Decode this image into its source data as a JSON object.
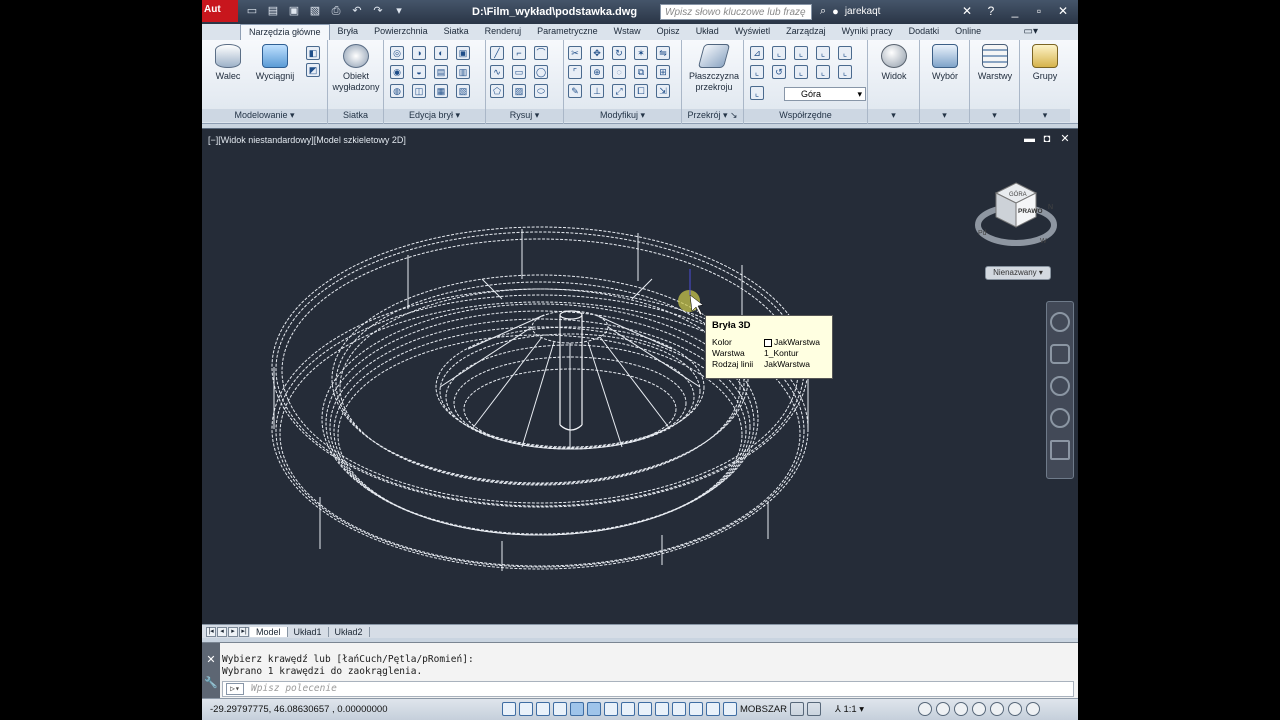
{
  "titlebar": {
    "app_logo": "Aut",
    "doc_title": "D:\\Film_wykład\\podstawka.dwg",
    "search_placeholder": "Wpisz słowo kluczowe lub frazę",
    "user_name": "jarekaqt"
  },
  "tabs": [
    "Narzędzia główne",
    "Bryła",
    "Powierzchnia",
    "Siatka",
    "Renderuj",
    "Parametryczne",
    "Wstaw",
    "Opisz",
    "Układ",
    "Wyświetl",
    "Zarządzaj",
    "Wyniki pracy",
    "Dodatki",
    "Online"
  ],
  "active_tab": "Narzędzia główne",
  "ribbon": {
    "panels": {
      "modelowanie": "Modelowanie",
      "siatka": "Siatka",
      "edycja_bryl": "Edycja brył",
      "rysuj": "Rysuj",
      "modyfikuj": "Modyfikuj",
      "przekroj": "Przekrój",
      "wspolrzedne": "Współrzędne"
    },
    "buttons": {
      "walec": "Walec",
      "wyciagnij": "Wyciągnij",
      "obiekt_wygladzony_1": "Obiekt",
      "obiekt_wygladzony_2": "wygładzony",
      "plaszczyzna_1": "Płaszczyzna",
      "plaszczyzna_2": "przekroju",
      "widok": "Widok",
      "wybor": "Wybór",
      "warstwy": "Warstwy",
      "grupy": "Grupy"
    },
    "view_combo": "Góra"
  },
  "viewport": {
    "label": "[−][Widok niestandardowy][Model szkieletowy 2D]",
    "viewcube_face": "PRAWO",
    "viewcube_top": "GÓRA",
    "compass": [
      "Pd",
      "W",
      "N"
    ],
    "named_view": "Nienazwany"
  },
  "tooltip": {
    "title": "Bryła 3D",
    "rows": [
      {
        "key": "Kolor",
        "value": "JakWarstwa"
      },
      {
        "key": "Warstwa",
        "value": "1_Kontur"
      },
      {
        "key": "Rodzaj linii",
        "value": "JakWarstwa"
      }
    ]
  },
  "layout_tabs": [
    "Model",
    "Układ1",
    "Układ2"
  ],
  "command": {
    "history": [
      "Wybierz krawędź lub [łańCuch/Pętla/pRomień]:",
      "Wybrano 1 krawędzi do zaokrąglenia."
    ],
    "input_placeholder": "Wpisz polecenie"
  },
  "status": {
    "coords": "-29.29797775, 46.08630657 , 0.00000000",
    "model_space": "MOBSZAR",
    "anno_scale": "1:1"
  }
}
